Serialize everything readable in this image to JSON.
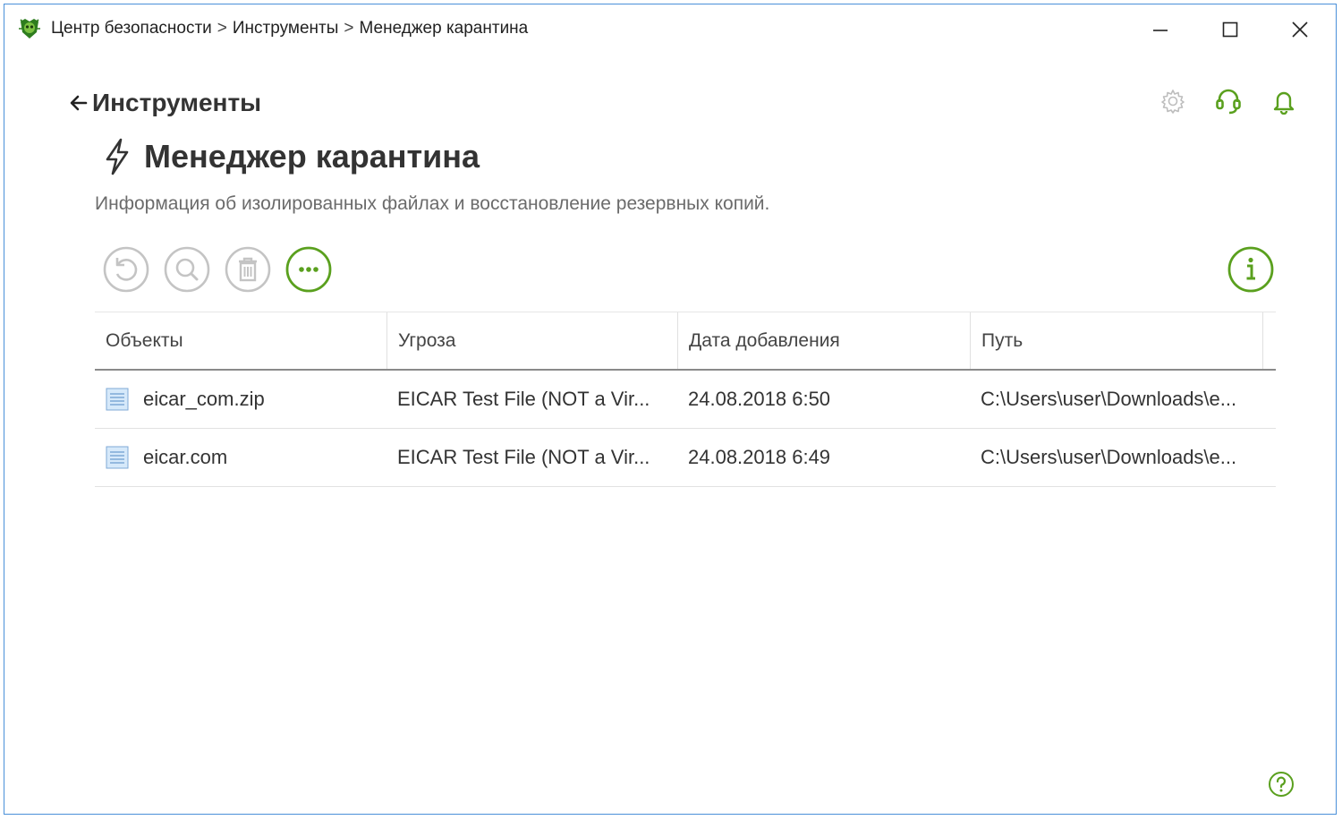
{
  "titlebar": {
    "breadcrumbs": [
      "Центр безопасности",
      "Инструменты",
      "Менеджер карантина"
    ],
    "separator": ">"
  },
  "header": {
    "back_label": "Инструменты",
    "title": "Менеджер карантина",
    "description": "Информация об изолированных файлах и восстановление резервных копий."
  },
  "colors": {
    "accent": "#5aa01e",
    "disabled": "#c4c4c4",
    "border": "#4a90d9"
  },
  "toolbar": {
    "buttons": [
      "restore-icon",
      "scan-icon",
      "delete-icon",
      "more-icon"
    ],
    "info": "info-icon"
  },
  "table": {
    "columns": [
      "Объекты",
      "Угроза",
      "Дата добавления",
      "Путь"
    ],
    "rows": [
      {
        "object": "eicar_com.zip",
        "threat": "EICAR Test File (NOT a Vir...",
        "date": "24.08.2018 6:50",
        "path": "C:\\Users\\user\\Downloads\\e..."
      },
      {
        "object": "eicar.com",
        "threat": "EICAR Test File (NOT a Vir...",
        "date": "24.08.2018 6:49",
        "path": "C:\\Users\\user\\Downloads\\e..."
      }
    ]
  }
}
